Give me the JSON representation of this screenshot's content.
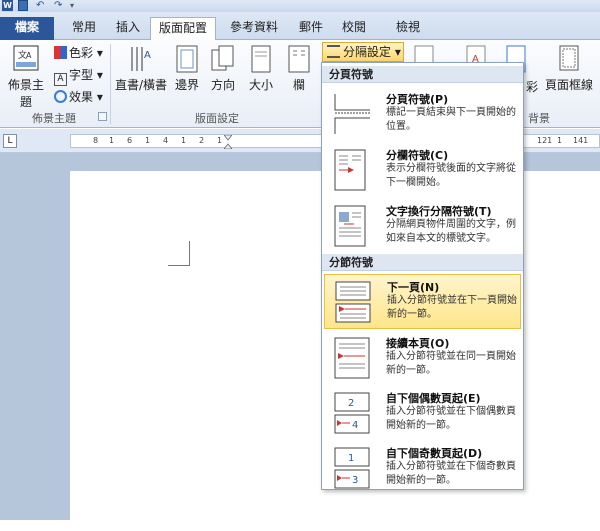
{
  "tabs": [
    "檔案",
    "常用",
    "插入",
    "版面配置",
    "參考資料",
    "郵件",
    "校閱",
    "檢視"
  ],
  "ribbon": {
    "theme_button": "佈景主題",
    "colors": "色彩",
    "fonts": "字型",
    "effects": "效果",
    "theme_group": "佈景主題",
    "orientation_text": "直書/橫書",
    "margins": "邊界",
    "direction": "方向",
    "size": "大小",
    "columns": "欄",
    "breaks": "分隔設定",
    "page_setup_group": "版面設定",
    "page_color_partial": "彩",
    "page_borders": "頁面框線",
    "background_group_partial": "背景"
  },
  "ruler": {
    "ticks": [
      "8",
      "1",
      "6",
      "1",
      "4",
      "1",
      "2",
      "1",
      "121",
      "1",
      "141"
    ]
  },
  "menu": {
    "section_page_breaks": "分頁符號",
    "section_section_breaks": "分節符號",
    "items": [
      {
        "title": "分頁符號(P)",
        "desc": "標記一頁結束與下一頁開始的位置。"
      },
      {
        "title": "分欄符號(C)",
        "desc": "表示分欄符號後面的文字將從下一欄開始。"
      },
      {
        "title": "文字換行分隔符號(T)",
        "desc": "分隔網頁物件周圍的文字，例如來自本文的標號文字。"
      },
      {
        "title": "下一頁(N)",
        "desc": "插入分節符號並在下一頁開始新的一節。"
      },
      {
        "title": "接續本頁(O)",
        "desc": "插入分節符號並在同一頁開始新的一節。"
      },
      {
        "title": "自下個偶數頁起(E)",
        "desc": "插入分節符號並在下個偶數頁開始新的一節。"
      },
      {
        "title": "自下個奇數頁起(D)",
        "desc": "插入分節符號並在下個奇數頁開始新的一節。"
      }
    ]
  },
  "doc": {
    "para_mark": "↵"
  },
  "colors": {
    "accent": "#2b579a",
    "highlight": "#ffe58a",
    "doc_bg": "#b5c5da"
  }
}
